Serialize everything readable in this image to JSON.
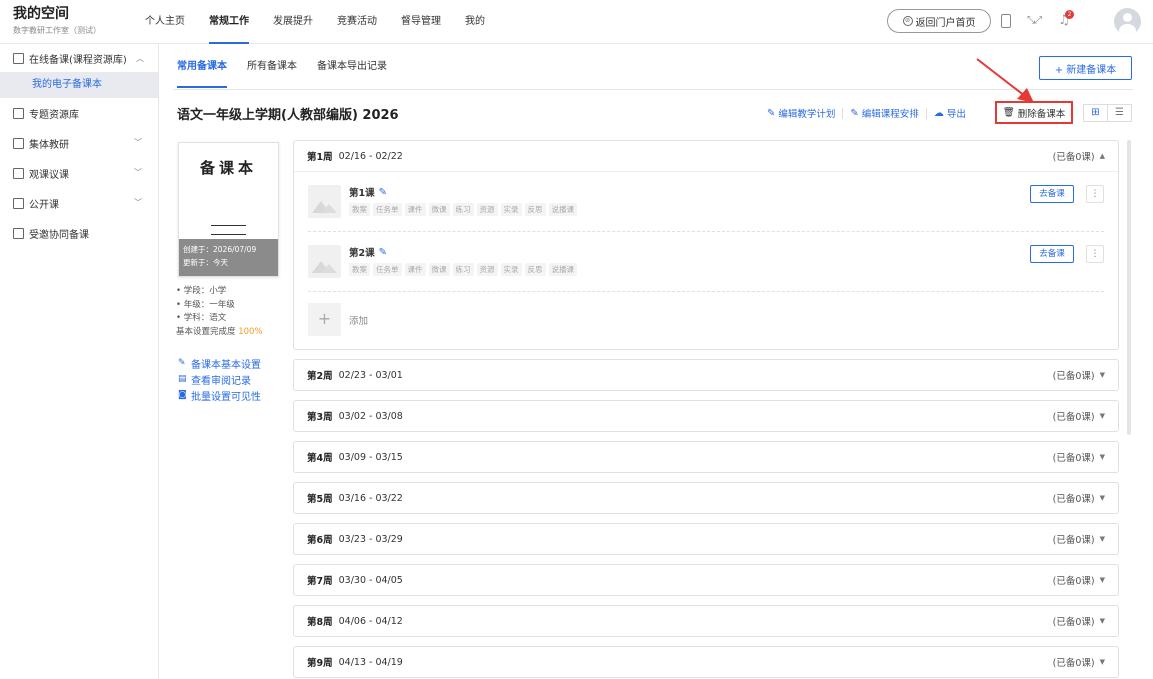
{
  "app": {
    "title": "我的空间",
    "subtitle": "数字教研工作室（测试）"
  },
  "nav": {
    "items": [
      "个人主页",
      "常规工作",
      "发展提升",
      "竞赛活动",
      "督导管理",
      "我的"
    ],
    "active_index": 1
  },
  "header": {
    "portal_button": "返回门户首页",
    "notification_count": "2"
  },
  "sidebar": {
    "items": [
      {
        "label": "在线备课(课程资源库)",
        "icon": "document-icon",
        "expanded": true
      },
      {
        "label": "专题资源库",
        "icon": "archive-icon"
      },
      {
        "label": "集体教研",
        "icon": "list-icon",
        "expandable": true
      },
      {
        "label": "观课议课",
        "icon": "chat-icon",
        "expandable": true
      },
      {
        "label": "公开课",
        "icon": "screen-icon",
        "expandable": true
      },
      {
        "label": "受邀协同备课",
        "icon": "org-icon"
      }
    ],
    "sub_item": "我的电子备课本"
  },
  "tabs": {
    "items": [
      "常用备课本",
      "所有备课本",
      "备课本导出记录"
    ],
    "active_index": 0
  },
  "new_button": "+ 新建备课本",
  "book": {
    "title": "语文一年级上学期(人教部编版) 2026",
    "actions": {
      "edit_plan": "编辑教学计划",
      "edit_schedule": "编辑课程安排",
      "export": "导出",
      "delete": "删除备课本"
    }
  },
  "cover": {
    "title": "备课本",
    "created": "创建于：2026/07/09",
    "updated": "更新于：今天"
  },
  "info": {
    "stage": "• 学段：小学",
    "grade": "• 年级：一年级",
    "subject": "• 学科：语文",
    "progress_label": "基本设置完成度",
    "progress_value": "100%"
  },
  "links": {
    "basic_settings": "备课本基本设置",
    "review_records": "查看审阅记录",
    "visibility": "批量设置可见性"
  },
  "weeks": [
    {
      "label": "第1周",
      "range": "02/16 - 02/22",
      "status": "(已备0课)"
    },
    {
      "label": "第2周",
      "range": "02/23 - 03/01",
      "status": "(已备0课)"
    },
    {
      "label": "第3周",
      "range": "03/02 - 03/08",
      "status": "(已备0课)"
    },
    {
      "label": "第4周",
      "range": "03/09 - 03/15",
      "status": "(已备0课)"
    },
    {
      "label": "第5周",
      "range": "03/16 - 03/22",
      "status": "(已备0课)"
    },
    {
      "label": "第6周",
      "range": "03/23 - 03/29",
      "status": "(已备0课)"
    },
    {
      "label": "第7周",
      "range": "03/30 - 04/05",
      "status": "(已备0课)"
    },
    {
      "label": "第8周",
      "range": "04/06 - 04/12",
      "status": "(已备0课)"
    },
    {
      "label": "第9周",
      "range": "04/13 - 04/19",
      "status": "(已备0课)"
    }
  ],
  "lessons": [
    {
      "name": "第1课",
      "chips": [
        "教案",
        "任务单",
        "课件",
        "微课",
        "练习",
        "资源",
        "实录",
        "反思",
        "说播课"
      ],
      "button": "去备课"
    },
    {
      "name": "第2课",
      "chips": [
        "教案",
        "任务单",
        "课件",
        "微课",
        "练习",
        "资源",
        "实录",
        "反思",
        "说播课"
      ],
      "button": "去备课"
    }
  ],
  "add_label": "添加",
  "colors": {
    "accent": "#2a6be3",
    "highlight": "#e53935",
    "progress": "#f29c1f"
  }
}
